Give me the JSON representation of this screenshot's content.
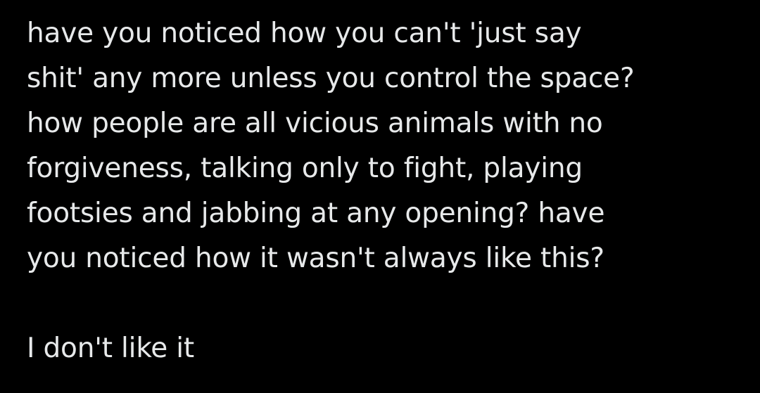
{
  "post": {
    "lines": [
      "have you noticed how you can't 'just say",
      "shit' any more unless you control the space?",
      "how people are all vicious animals with no",
      "forgiveness, talking only to fight, playing",
      "footsies and jabbing at any opening? have",
      "you noticed how it wasn't always like this?",
      "",
      "I don't like it"
    ]
  },
  "colors": {
    "background": "#000000",
    "text": "#e7e9ea"
  }
}
